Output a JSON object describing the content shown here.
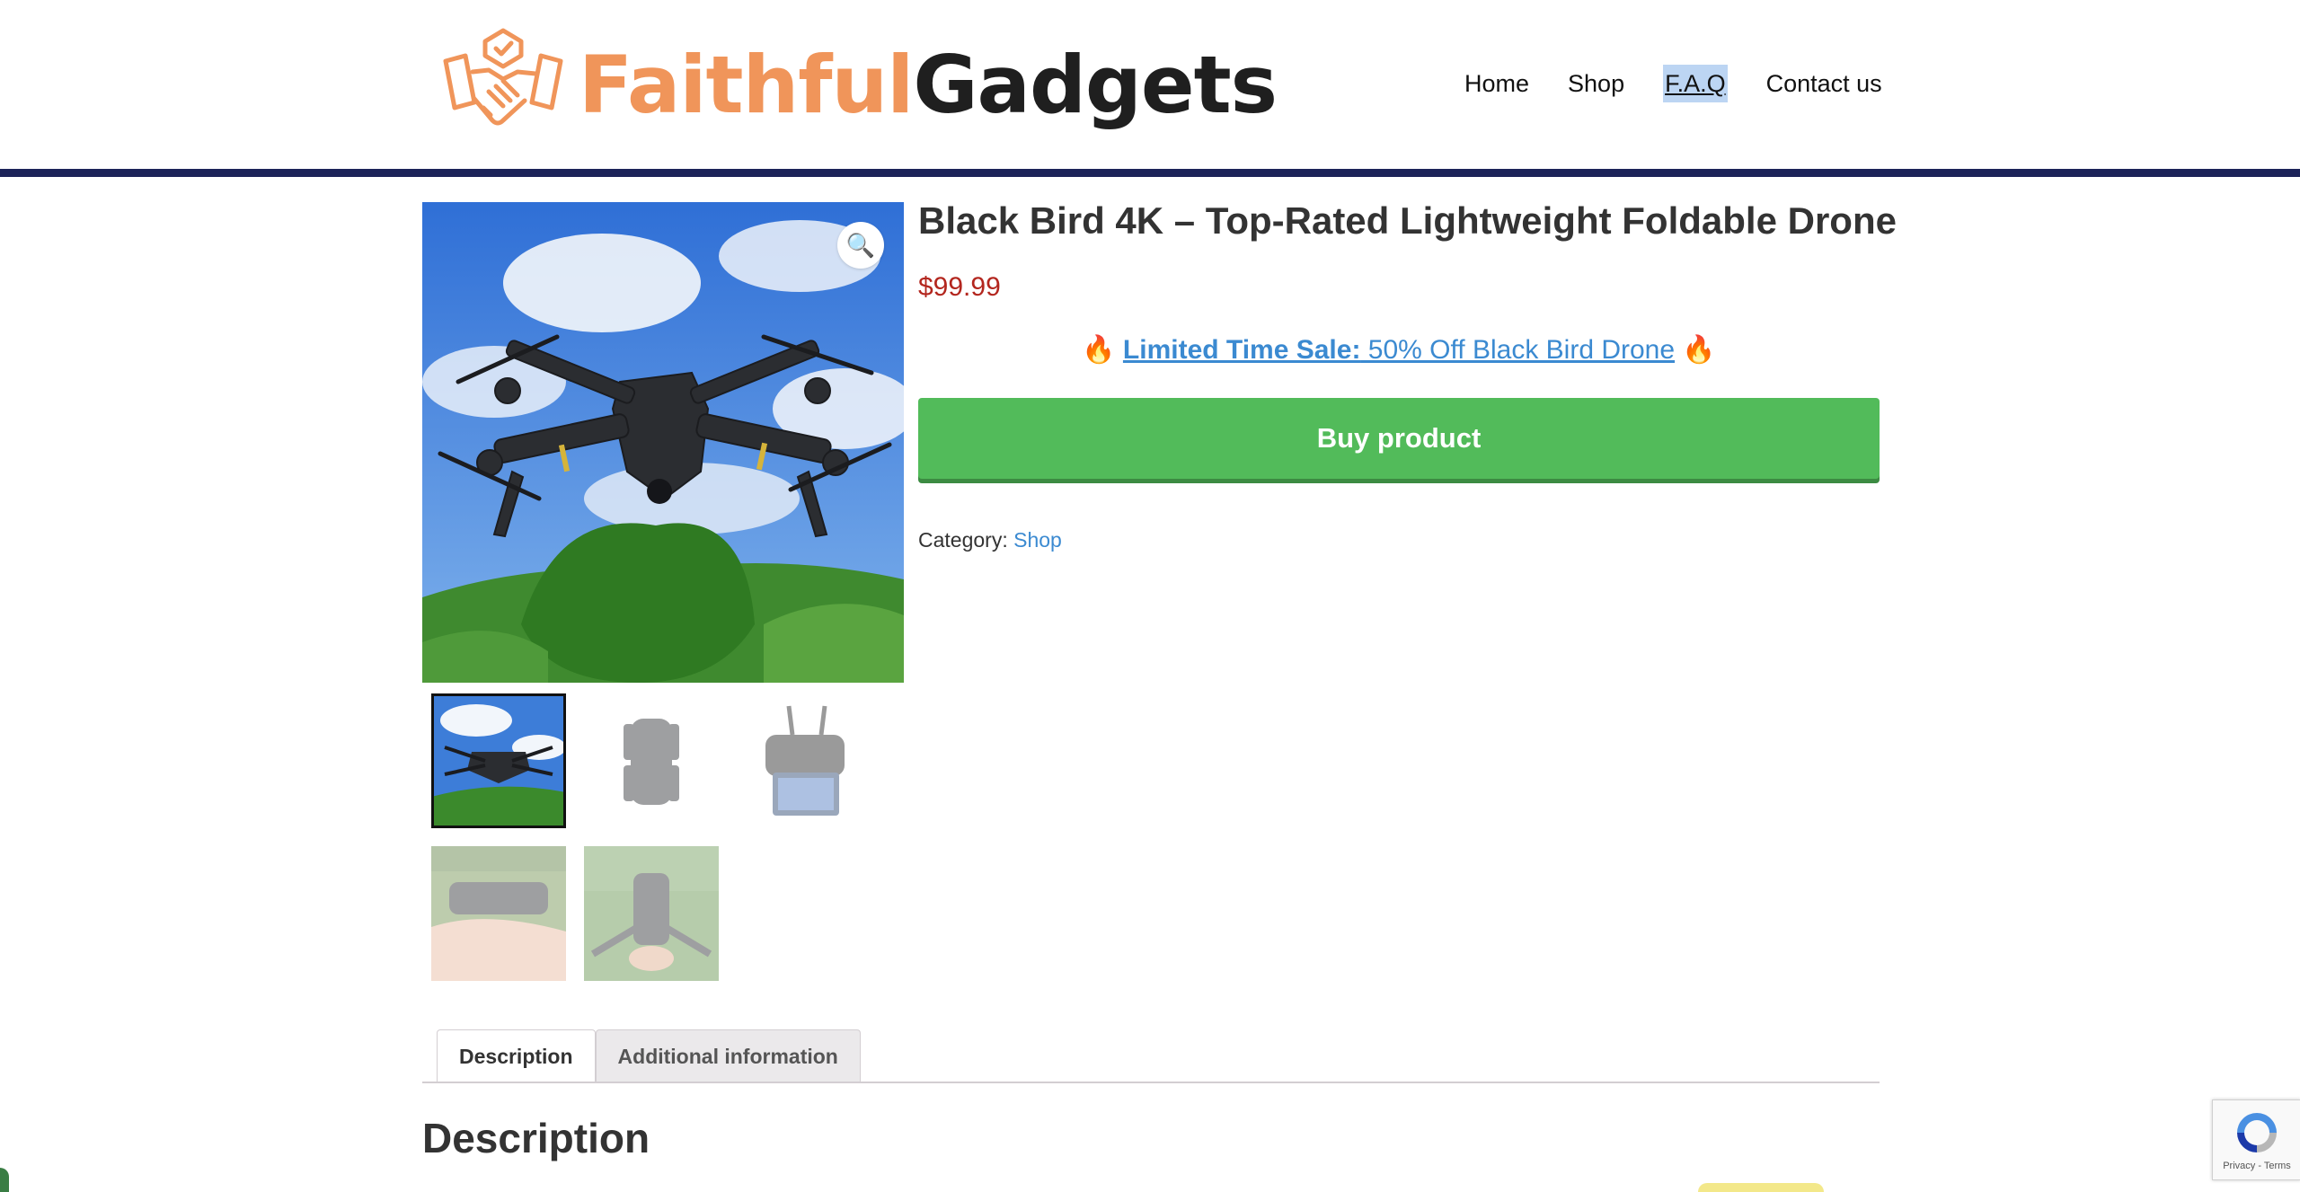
{
  "header": {
    "brand_part1": "Faithful",
    "brand_part2": "Gadgets",
    "nav": [
      "Home",
      "Shop",
      "F.A.Q",
      "Contact us"
    ]
  },
  "product": {
    "title": "Black Bird 4K – Top-Rated Lightweight Foldable Drone",
    "price": "$99.99",
    "sale_emoji": "🔥",
    "sale_bold": "Limited Time Sale:",
    "sale_text": " 50% Off Black Bird Drone",
    "buy_label": "Buy product",
    "category_label": "Category:",
    "category_link": "Shop"
  },
  "tabs": [
    "Description",
    "Additional information"
  ],
  "description_heading": "Description",
  "recaptcha": {
    "footer": "Privacy - Terms"
  },
  "colors": {
    "accent_green": "#52bb5a",
    "brand_orange": "#f0955a",
    "header_bar": "#1c2359",
    "price_red": "#b3261e",
    "link_blue": "#3b8ad1"
  }
}
